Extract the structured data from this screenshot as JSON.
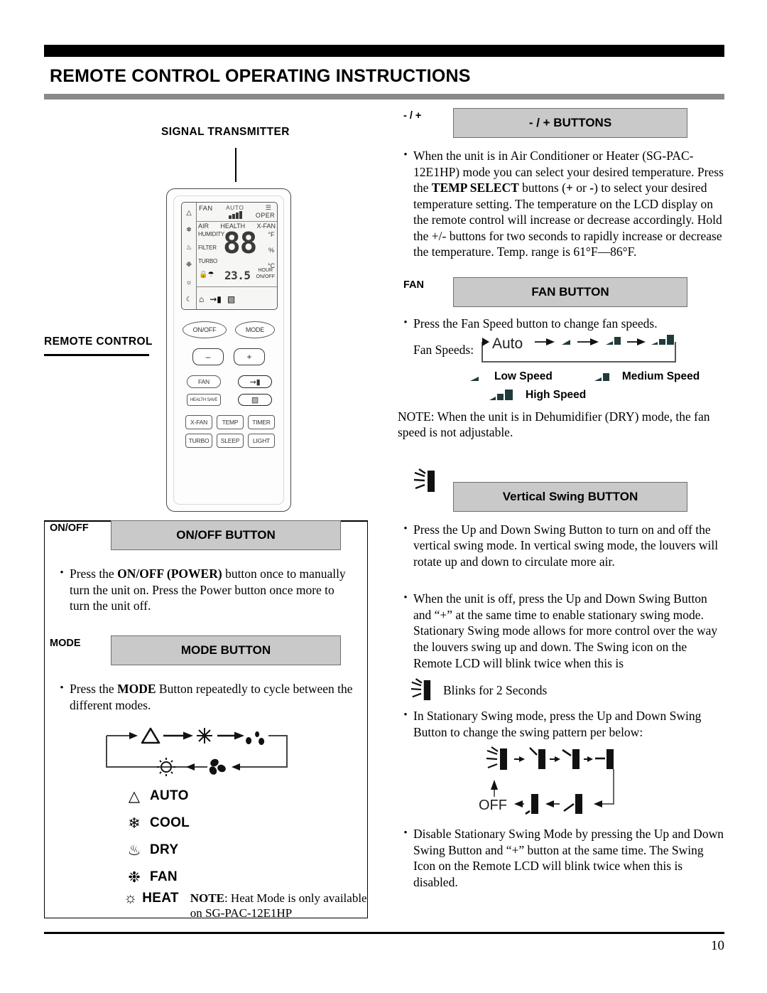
{
  "header": {
    "title": "REMOTE CONTROL OPERATING INSTRUCTIONS"
  },
  "footer": {
    "page_number": "10"
  },
  "left_column": {
    "signal_transmitter_label": "SIGNAL TRANSMITTER",
    "remote_control_label": "REMOTE CONTROL",
    "remote": {
      "lcd": {
        "fan_label": "FAN",
        "auto_label": "AUTO",
        "oper_label": "OPER",
        "row2": [
          "AIR",
          "HEALTH",
          "X-FAN"
        ],
        "left_words": [
          "HUMIDITY",
          "FILTER",
          "TURBO"
        ],
        "right_units": [
          "°F",
          "%",
          "°C"
        ],
        "main_digits": "88",
        "small_temp": "23.5",
        "hour_label": "HOUR",
        "onoff_label": "ON/OFF"
      },
      "buttons": {
        "onoff": "ON/OFF",
        "mode": "MODE",
        "minus": "–",
        "plus": "+",
        "fan": "FAN",
        "health_save": "HEALTH SAVE",
        "x_fan": "X-FAN",
        "temp": "TEMP",
        "timer": "TIMER",
        "turbo": "TURBO",
        "sleep": "SLEEP",
        "light": "LIGHT"
      }
    },
    "onoff_section": {
      "tab_label": "ON/OFF",
      "box_title": "ON/OFF BUTTON",
      "bullet_1_pre": "Press the ",
      "bullet_1_bold": "ON/OFF (POWER)",
      "bullet_1_post": " button once to manually turn the unit on. Press the Power button once more to turn the unit off."
    },
    "mode_section": {
      "tab_label": "MODE",
      "box_title": "MODE BUTTON",
      "bullet_1_pre": "Press the ",
      "bullet_1_bold": "MODE",
      "bullet_1_post": " Button repeatedly to cycle between the different modes.",
      "cycle_order": [
        "AUTO",
        "COOL",
        "DRY",
        "FAN",
        "HEAT"
      ],
      "modes": [
        {
          "icon": "auto-triangle-icon",
          "name": "AUTO"
        },
        {
          "icon": "snowflake-icon",
          "name": "COOL"
        },
        {
          "icon": "water-drops-icon",
          "name": "DRY"
        },
        {
          "icon": "fan-blades-icon",
          "name": "FAN"
        },
        {
          "icon": "sun-icon",
          "name": "HEAT"
        }
      ],
      "note_bold": "NOTE",
      "note_text": ": Heat Mode is only available on SG-PAC-12E1HP"
    }
  },
  "right_column": {
    "plusminus_section": {
      "tab_label": "- / +",
      "box_title": "- / + BUTTONS",
      "bullet_1_part1": "When the unit is in Air Conditioner or Heater (SG-PAC-12E1HP) mode you can select your desired temperature. Press the ",
      "bullet_1_bold1": "TEMP SELECT",
      "bullet_1_part2": " buttons (",
      "bullet_1_bold2": "+",
      "bullet_1_part3": " or ",
      "bullet_1_bold3": "-",
      "bullet_1_part4": ")  to select your desired temperature setting. The temperature on the LCD display on the remote control will increase or decrease accordingly. Hold the +/- buttons for two seconds to rapidly increase or decrease the temperature.  Temp. range is 61°F—86°F."
    },
    "fan_section": {
      "tab_label": "FAN",
      "box_title": "FAN BUTTON",
      "bullet_1": "Press the Fan Speed button to change  fan speeds.",
      "fan_speeds_label": "Fan Speeds:",
      "auto_label": "Auto",
      "legend": [
        {
          "icon": "fan-bar-low-icon",
          "label": "Low Speed"
        },
        {
          "icon": "fan-bar-medium-icon",
          "label": "Medium Speed"
        },
        {
          "icon": "fan-bar-high-icon",
          "label": "High Speed"
        }
      ],
      "note": "NOTE: When the unit is in Dehumidifier (DRY) mode, the fan speed is not adjustable."
    },
    "swing_section": {
      "tab_label_icon": "swing-blink-icon",
      "box_title": "Vertical Swing BUTTON",
      "bullet_1": "Press the Up and Down Swing Button to turn on and off the vertical swing mode. In vertical swing mode, the louvers will rotate up and down to circulate more air.",
      "bullet_2": "When the unit is off, press the Up and Down Swing Button and “+” at the same time to enable stationary swing mode. Stationary Swing mode allows for more control over the way the louvers swing up and down. The Swing icon on the Remote LCD will blink twice when this is",
      "blink_label": "Blinks for 2 Seconds",
      "bullet_3": "In Stationary Swing mode, press the Up and Down Swing Button to change the swing pattern per below:",
      "swing_off_label": "OFF",
      "bullet_4": "Disable Stationary Swing Mode by pressing the Up and Down Swing Button and “+” button at the same time. The Swing Icon on the Remote LCD will blink twice when this is disabled."
    }
  },
  "colors": {
    "header_bar_top": "#000000",
    "header_bar_bottom": "#8a8a8a",
    "callout_box_fill": "#c9c9c9",
    "callout_box_border": "#6e6e6e",
    "fan_bar": "#1f3b3b"
  }
}
